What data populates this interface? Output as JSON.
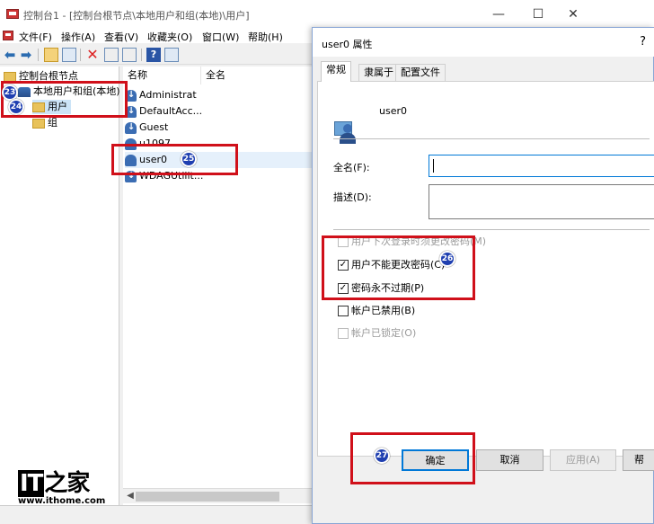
{
  "window": {
    "title": "控制台1 - [控制台根节点\\本地用户和组(本地)\\用户]",
    "minimize": "—",
    "maximize": "☐",
    "close": "✕"
  },
  "menu": [
    "文件(F)",
    "操作(A)",
    "查看(V)",
    "收藏夹(O)",
    "窗口(W)",
    "帮助(H)"
  ],
  "toolbar": {
    "back": "⬅",
    "forward": "➡",
    "delete": "✕",
    "help": "?"
  },
  "tree": {
    "root": "控制台根节点",
    "group": "本地用户和组(本地)",
    "users": "用户",
    "groups": "组"
  },
  "list": {
    "col_name": "名称",
    "col_fullname": "全名",
    "rows": [
      "Administrat",
      "DefaultAcc...",
      "Guest",
      "u1097",
      "user0",
      "WDAGUtilit..."
    ]
  },
  "dialog": {
    "title": "user0 属性",
    "help": "?",
    "tabs": [
      "常规",
      "隶属于",
      "配置文件"
    ],
    "username": "user0",
    "fullname_label": "全名(F):",
    "fullname_value": "",
    "description_label": "描述(D):",
    "description_value": "",
    "checkboxes": [
      {
        "label": "用户下次登录时须更改密码(M)",
        "checked": false,
        "disabled": true
      },
      {
        "label": "用户不能更改密码(C)",
        "checked": true,
        "disabled": false
      },
      {
        "label": "密码永不过期(P)",
        "checked": true,
        "disabled": false
      },
      {
        "label": "帐户已禁用(B)",
        "checked": false,
        "disabled": false
      },
      {
        "label": "帐户已锁定(O)",
        "checked": false,
        "disabled": true
      }
    ],
    "buttons": {
      "ok": "确定",
      "cancel": "取消",
      "apply": "应用(A)",
      "help": "帮"
    }
  },
  "annotations": [
    "23",
    "24",
    "25",
    "26",
    "27"
  ],
  "watermark": {
    "logo": "IT之家",
    "url": "www.ithome.com"
  },
  "colors": {
    "highlight": "#d0101a",
    "badge": "#1f3fb0",
    "focus": "#0078d7"
  }
}
